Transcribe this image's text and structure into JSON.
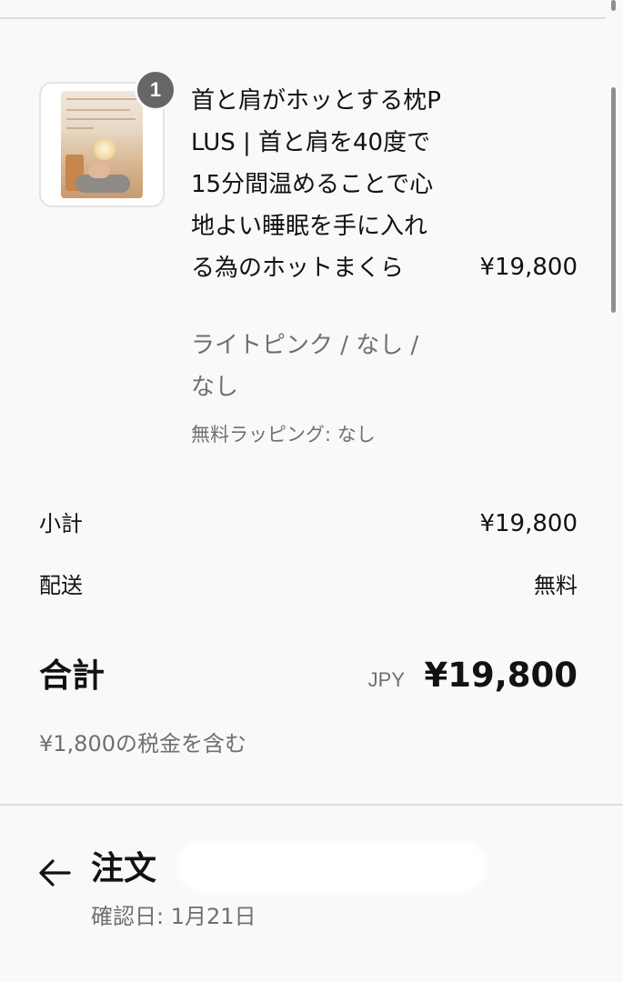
{
  "product": {
    "quantity": "1",
    "title": "首と肩がホッとする枕PLUS | 首と肩を40度で15分間温めることで心地よい睡眠を手に入れる為のホットまくら",
    "variant": "ライトピンク / なし / なし",
    "gift_wrapping": "無料ラッピング: なし",
    "price": "¥19,800",
    "thumbnail_icon": "product-image-icon"
  },
  "summary": {
    "subtotal_label": "小計",
    "subtotal_value": "¥19,800",
    "shipping_label": "配送",
    "shipping_value": "無料",
    "total_label": "合計",
    "currency": "JPY",
    "total_value": "¥19,800",
    "tax_note": "¥1,800の税金を含む"
  },
  "order": {
    "title": "注文",
    "confirmation_date": "確認日: 1月21日",
    "back_icon": "arrow-left-icon"
  },
  "colors": {
    "background": "#f9f9f9",
    "text": "#121212",
    "muted": "#707070",
    "badge": "#666666",
    "divider": "#dedede"
  }
}
